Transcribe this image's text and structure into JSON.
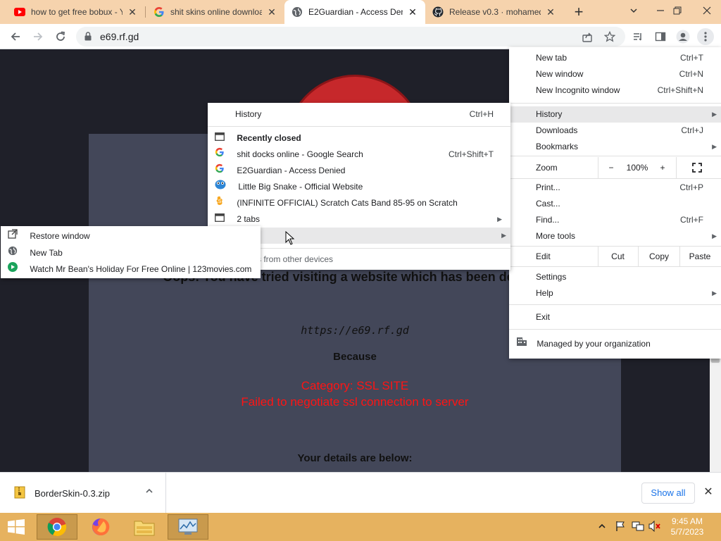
{
  "tabs": [
    {
      "title": "how to get free bobux - Y",
      "icon": "youtube-icon"
    },
    {
      "title": "shit skins online downloa",
      "icon": "google-icon"
    },
    {
      "title": "E2Guardian - Access Den",
      "icon": "globe-icon"
    },
    {
      "title": "Release v0.3 · mohamed",
      "icon": "github-icon"
    }
  ],
  "toolbar": {
    "url": "e69.rf.gd"
  },
  "page": {
    "oops_line": "Oops! You have tried visiting a website which has been deemed",
    "blocked_url": "https://e69.rf.gd",
    "because": "Because",
    "category": "Category: SSL SITE",
    "reason": "Failed to negotiate ssl connection to server",
    "details": "Your details are below:"
  },
  "chrome_menu": {
    "new_tab": {
      "label": "New tab",
      "shortcut": "Ctrl+T"
    },
    "new_window": {
      "label": "New window",
      "shortcut": "Ctrl+N"
    },
    "incognito": {
      "label": "New Incognito window",
      "shortcut": "Ctrl+Shift+N"
    },
    "history": {
      "label": "History"
    },
    "downloads": {
      "label": "Downloads",
      "shortcut": "Ctrl+J"
    },
    "bookmarks": {
      "label": "Bookmarks"
    },
    "zoom": {
      "label": "Zoom",
      "minus": "−",
      "value": "100%",
      "plus": "+"
    },
    "print": {
      "label": "Print...",
      "shortcut": "Ctrl+P"
    },
    "cast": {
      "label": "Cast..."
    },
    "find": {
      "label": "Find...",
      "shortcut": "Ctrl+F"
    },
    "more_tools": {
      "label": "More tools"
    },
    "edit": {
      "label": "Edit",
      "cut": "Cut",
      "copy": "Copy",
      "paste": "Paste"
    },
    "settings": {
      "label": "Settings"
    },
    "help": {
      "label": "Help"
    },
    "exit": {
      "label": "Exit"
    },
    "managed": {
      "label": "Managed by your organization"
    }
  },
  "history_menu": {
    "history": {
      "label": "History",
      "shortcut": "Ctrl+H"
    },
    "recently_closed": "Recently closed",
    "items": [
      {
        "label": "shit docks online - Google Search",
        "shortcut": "Ctrl+Shift+T",
        "icon": "google-icon"
      },
      {
        "label": "E2Guardian - Access Denied",
        "shortcut": "",
        "icon": "google-icon"
      },
      {
        "label": "Little Big Snake - Official Website",
        "shortcut": "",
        "icon": "snake-icon"
      },
      {
        "label": "(INFINITE OFFICIAL) Scratch Cats Band 85-95 on Scratch",
        "shortcut": "",
        "icon": "scratch-icon"
      }
    ],
    "two_tabs": "2 tabs",
    "other_devices": "s from other devices"
  },
  "window_submenu": {
    "items": [
      {
        "label": "Restore window",
        "icon": "restore-icon"
      },
      {
        "label": "New Tab",
        "icon": "globe-icon"
      },
      {
        "label": "Watch Mr Bean's Holiday For Free Online | 123movies.com",
        "icon": "play-icon"
      }
    ]
  },
  "download": {
    "filename": "BorderSkin-0.3.zip",
    "show_all": "Show all"
  },
  "taskbar": {
    "time": "9:45 AM",
    "date": "5/7/2023"
  }
}
